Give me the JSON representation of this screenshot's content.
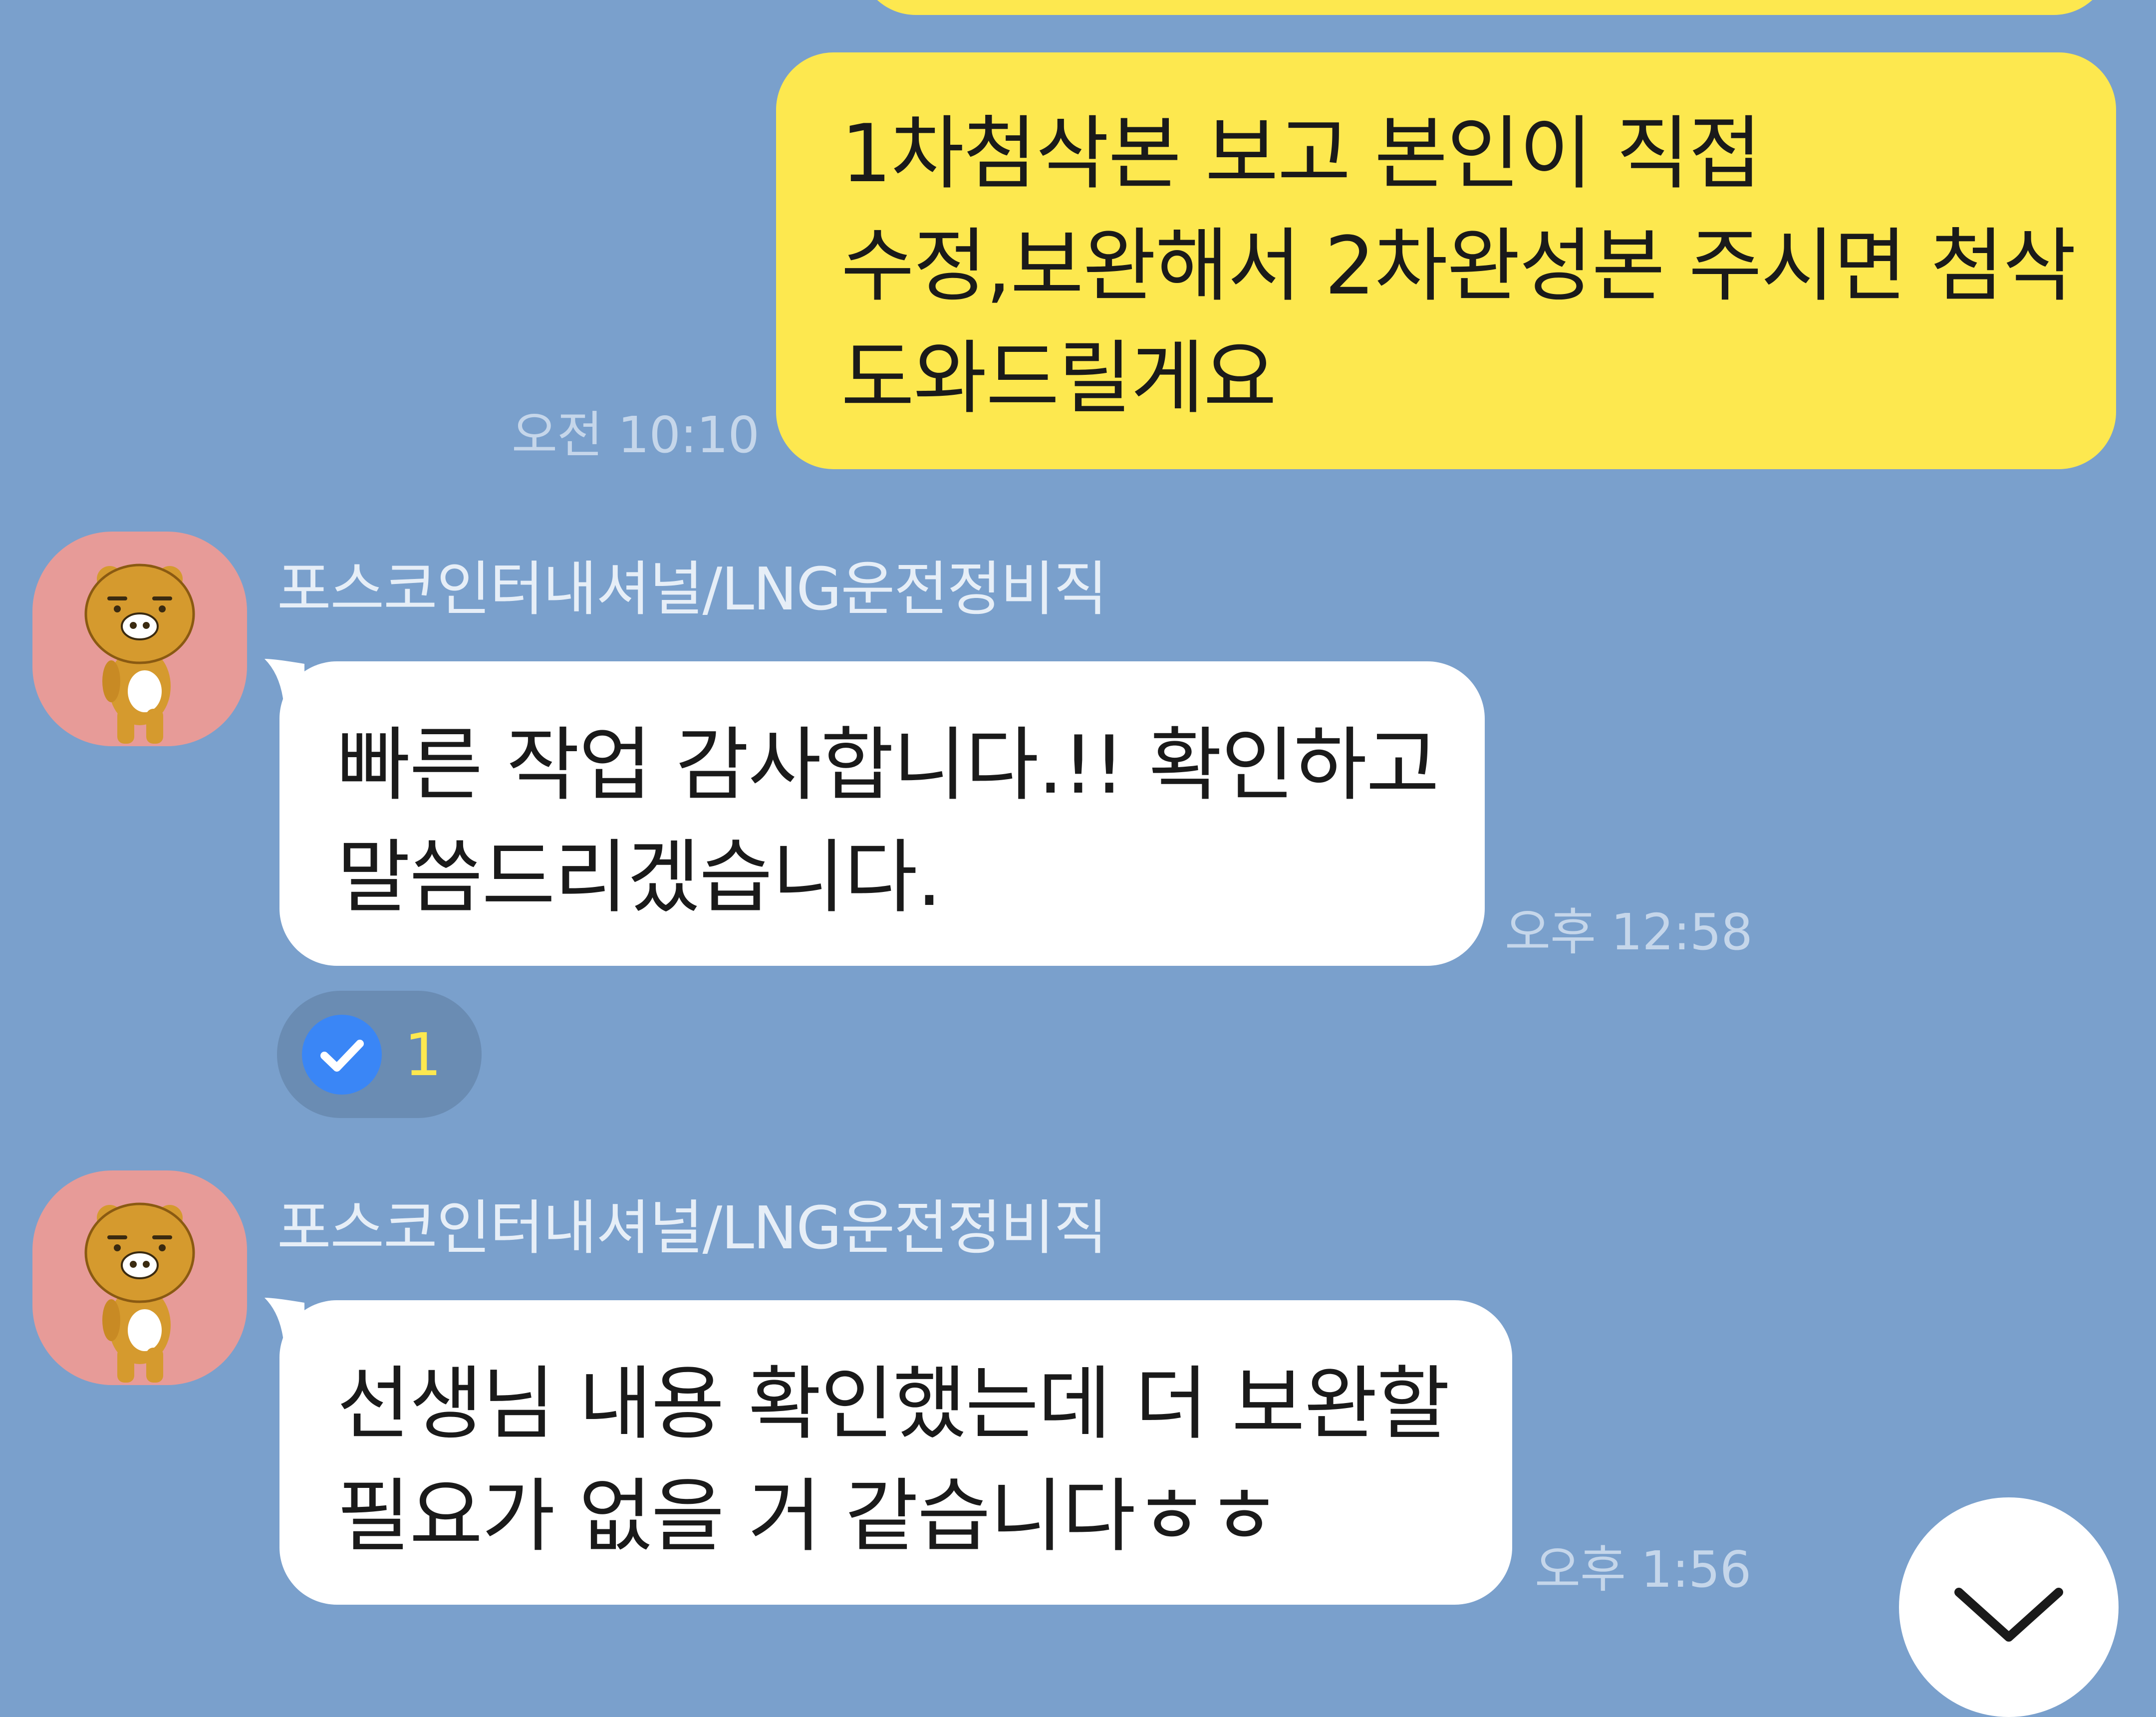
{
  "messages": [
    {
      "direction": "outgoing",
      "text": "1차첨삭본 보고 본인이 직접\n수정,보완해서 2차완성본 주시면 첨삭\n도와드릴게요",
      "time": "오전 10:10"
    },
    {
      "direction": "incoming",
      "sender": "포스코인터내셔널/LNG운전정비직",
      "text": "빠른 작업 감사합니다.!! 확인하고\n말씀드리겠습니다.",
      "time": "오후 12:58",
      "reaction_count": "1"
    },
    {
      "direction": "incoming",
      "sender": "포스코인터내셔널/LNG운전정비직",
      "text": "선생님 내용 확인했는데 더 보완할\n필요가 없을 거 같습니다ㅎㅎ",
      "time": "오후 1:56"
    }
  ],
  "icons": {
    "reaction": "check-icon",
    "scroll_down": "chevron-down-icon",
    "avatar": "bear-character-avatar"
  },
  "colors": {
    "background": "#7aa0cc",
    "outgoing_bubble": "#fde84f",
    "incoming_bubble": "#ffffff",
    "avatar_bg": "#e79b98",
    "check": "#3a86f6"
  }
}
